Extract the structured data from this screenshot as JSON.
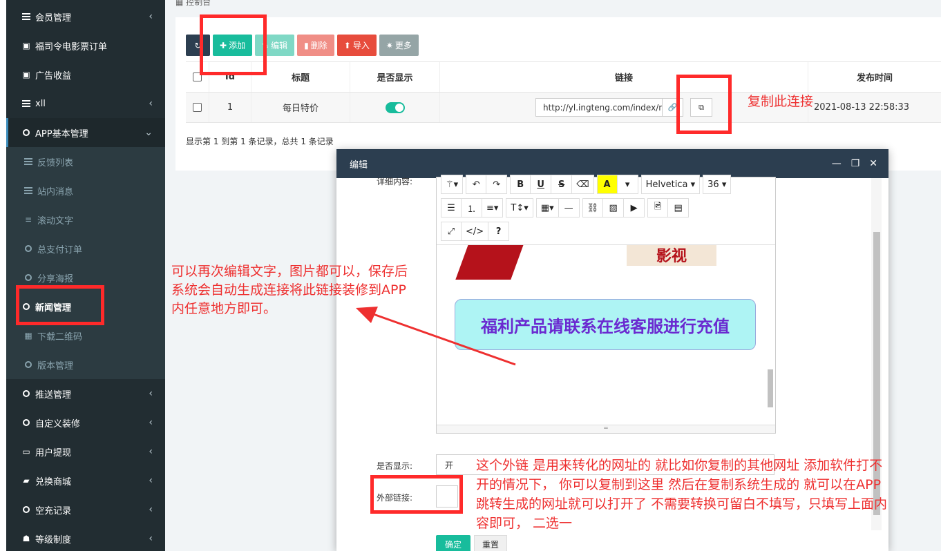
{
  "breadcrumb": "控制台",
  "sidebar": {
    "items": [
      {
        "label": "会员管理",
        "icon": "list-icon",
        "chevron": "‹"
      },
      {
        "label": "福司令电影票订单",
        "icon": "file-icon",
        "chevron": ""
      },
      {
        "label": "广告收益",
        "icon": "font-icon",
        "chevron": ""
      },
      {
        "label": "xll",
        "icon": "list-icon",
        "chevron": "‹"
      },
      {
        "label": "APP基本管理",
        "icon": "circle-icon",
        "chevron": "⌄"
      },
      {
        "label": "反馈列表",
        "icon": "list-icon",
        "chevron": ""
      },
      {
        "label": "站内消息",
        "icon": "list-icon",
        "chevron": ""
      },
      {
        "label": "滚动文字",
        "icon": "bars-icon",
        "chevron": ""
      },
      {
        "label": "总支付订单",
        "icon": "circle-icon",
        "chevron": ""
      },
      {
        "label": "分享海报",
        "icon": "circle-icon",
        "chevron": ""
      },
      {
        "label": "新闻管理",
        "icon": "circle-icon",
        "chevron": ""
      },
      {
        "label": "下载二维码",
        "icon": "qrcode-icon",
        "chevron": ""
      },
      {
        "label": "版本管理",
        "icon": "circle-icon",
        "chevron": ""
      },
      {
        "label": "推送管理",
        "icon": "circle-icon",
        "chevron": "‹"
      },
      {
        "label": "自定义装修",
        "icon": "circle-icon",
        "chevron": "‹"
      },
      {
        "label": "用户提现",
        "icon": "money-icon",
        "chevron": "‹"
      },
      {
        "label": "兑换商城",
        "icon": "bag-icon",
        "chevron": "‹"
      },
      {
        "label": "空充记录",
        "icon": "circle-icon",
        "chevron": "‹"
      },
      {
        "label": "等级制度",
        "icon": "users-icon",
        "chevron": "‹"
      }
    ]
  },
  "toolbar": {
    "refresh_label": "",
    "add_label": "添加",
    "edit_label": "编辑",
    "delete_label": "删除",
    "import_label": "导入",
    "more_label": "更多"
  },
  "table": {
    "headers": [
      "Id",
      "标题",
      "是否显示",
      "链接",
      "发布时间"
    ],
    "rows": [
      {
        "id": "1",
        "title": "每日特价",
        "show": true,
        "link": "http://yl.ingteng.com/index/new",
        "time": "2021-08-13 22:58:33"
      }
    ]
  },
  "records_text": "显示第 1 到第 1 条记录，总共 1 条记录",
  "annotations": {
    "copy_note": "复制此连接",
    "edit_note_1": "可以再次编辑文字，图片都可以，保存后",
    "edit_note_2": "系统会自动生成连接将此链接装修到APP",
    "edit_note_3": "内任意地方即可。",
    "ext_note_1": "这个外链 是用来转化的网址的  就比如你复制的其他网址 添加软件打不",
    "ext_note_2": "开的情况下，  你可以复制到这里  然后在复制系统生成的 就可以在APP",
    "ext_note_3": "跳转生成的网址就可以打开了  不需要转换可留白不填写，只填写上面内",
    "ext_note_4": "容即可，  二选一"
  },
  "modal": {
    "title": "编辑",
    "content_label": "详细内容:",
    "font_name": "Helvetica",
    "font_size": "36",
    "banner_text": "影视",
    "cyan_text": "福利产品请联系在线客服进行充值",
    "show_label": "是否显示:",
    "show_value": "开",
    "ext_label": "外部链接:",
    "ok_label": "确定",
    "reset_label": "重置"
  }
}
